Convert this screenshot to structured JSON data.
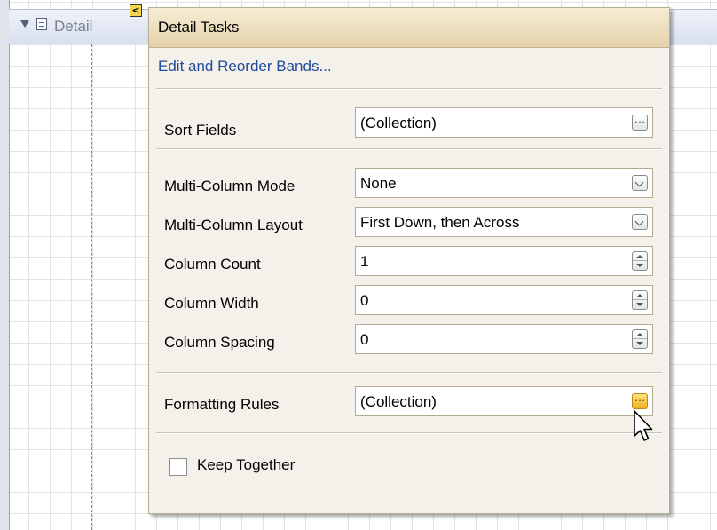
{
  "band": {
    "label": "Detail",
    "smart_tag_glyph": "<"
  },
  "panel": {
    "title": "Detail Tasks",
    "link": "Edit and Reorder Bands...",
    "rows": [
      {
        "label": "Sort Fields",
        "value": "(Collection)",
        "control": "ellipsis"
      },
      {
        "label": "Multi-Column Mode",
        "value": "None",
        "control": "dropdown"
      },
      {
        "label": "Multi-Column Layout",
        "value": "First Down, then Across",
        "control": "dropdown"
      },
      {
        "label": "Column Count",
        "value": "1",
        "control": "spinner"
      },
      {
        "label": "Column Width",
        "value": "0",
        "control": "spinner"
      },
      {
        "label": "Column Spacing",
        "value": "0",
        "control": "spinner"
      },
      {
        "label": "Formatting Rules",
        "value": "(Collection)",
        "control": "ellipsis",
        "state": "hover"
      }
    ],
    "keep_together": {
      "label": "Keep Together",
      "checked": false
    }
  },
  "colors": {
    "title_bar": "#e3d1ab",
    "panel_bg": "#f4f1ea",
    "link": "#1f4b9a",
    "hover_button": "#f0b323"
  }
}
